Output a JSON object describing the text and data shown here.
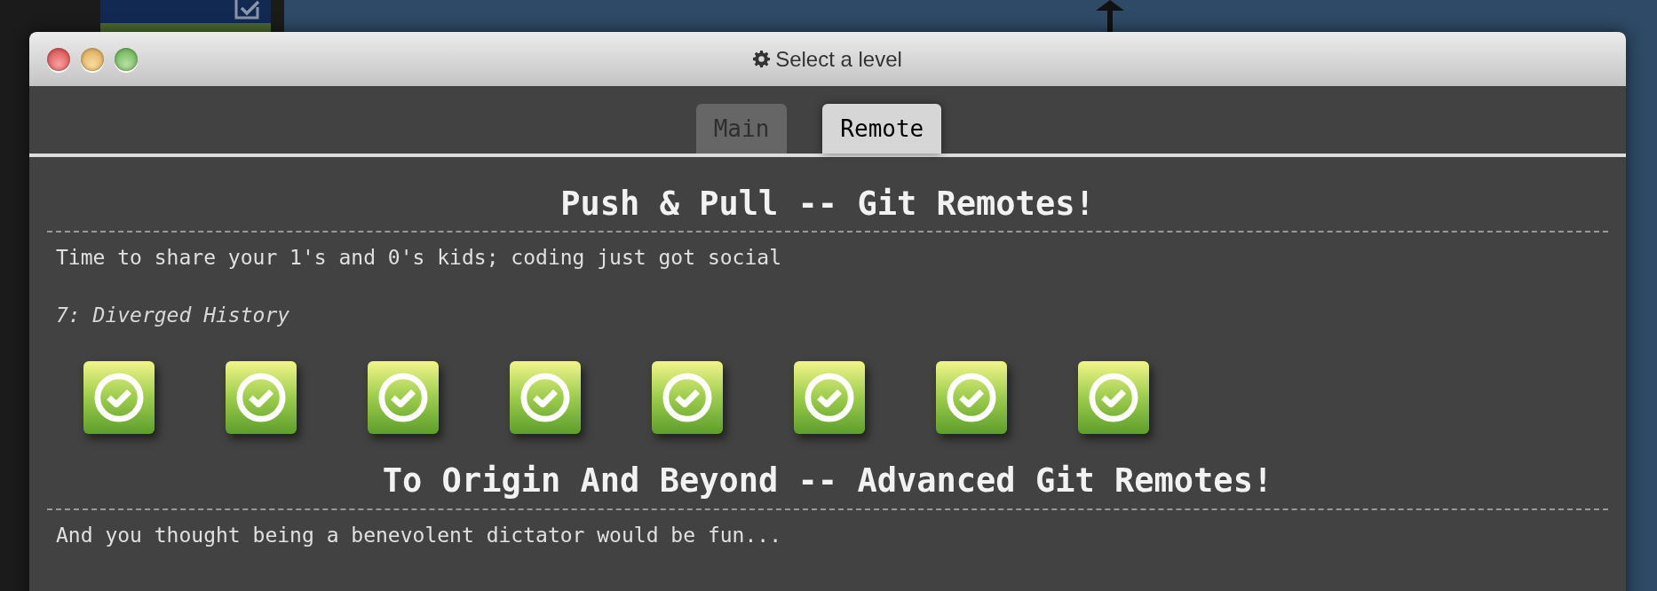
{
  "window": {
    "title": "Select a level"
  },
  "tabs": [
    {
      "label": "Main",
      "selected": false
    },
    {
      "label": "Remote",
      "selected": true
    }
  ],
  "sections": [
    {
      "title": "Push & Pull -- Git Remotes!",
      "description": "Time to share your 1's and 0's kids; coding just got social",
      "level_name": "7: Diverged History",
      "levels": [
        {
          "solved": true
        },
        {
          "solved": true
        },
        {
          "solved": true
        },
        {
          "solved": true
        },
        {
          "solved": true
        },
        {
          "solved": true
        },
        {
          "solved": true
        },
        {
          "solved": true
        }
      ]
    },
    {
      "title": "To Origin And Beyond -- Advanced Git Remotes!",
      "description": "And you thought being a benevolent dictator would be fun..."
    }
  ]
}
